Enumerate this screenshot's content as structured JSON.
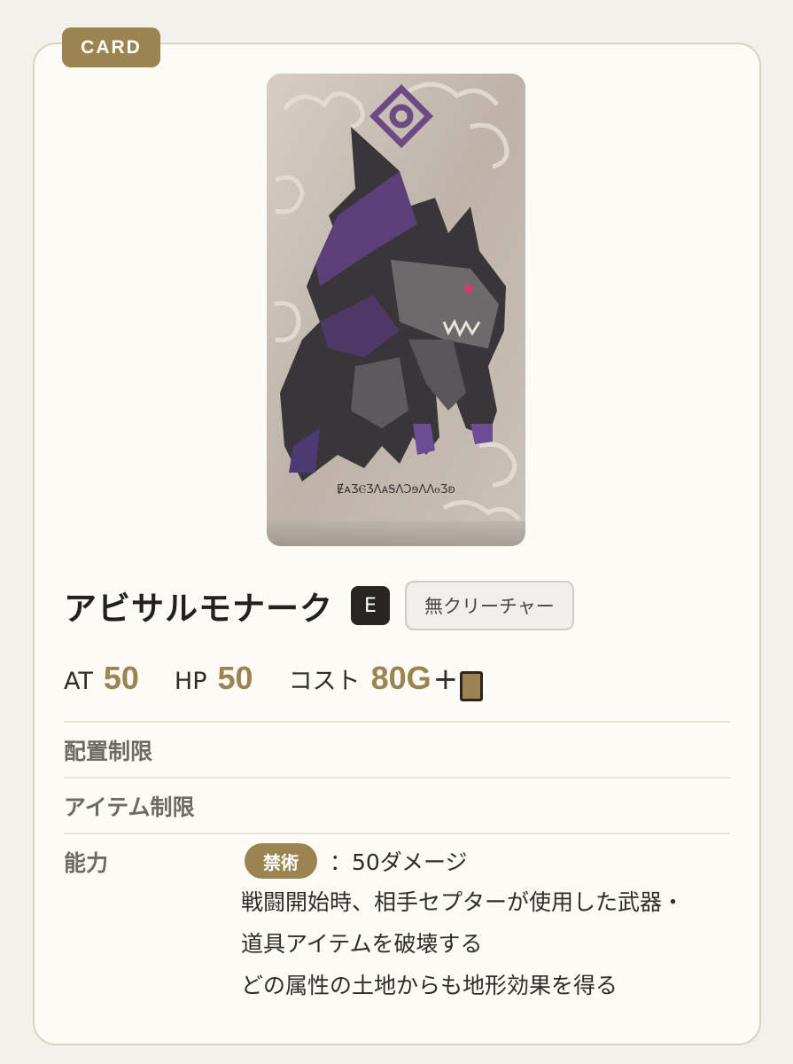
{
  "tag": "CARD",
  "card": {
    "name": "アビサルモナーク",
    "rank": "E",
    "type": "無クリーチャー",
    "art_script": "ɆᴀƷⲈƷɅᴀᎦɅƆɘɅɅⲑƷʚ"
  },
  "stats": {
    "at_label": "AT",
    "at_value": "50",
    "hp_label": "HP",
    "hp_value": "50",
    "cost_label": "コスト",
    "cost_value": "80G",
    "cost_plus": "+"
  },
  "rows": {
    "placement_label": "配置制限",
    "item_label": "アイテム制限",
    "ability_label": "能力"
  },
  "ability": {
    "tag": "禁術",
    "first_text": "：50ダメージ",
    "lines": [
      "戦闘開始時、相手セプターが使用した武器・",
      "道具アイテムを破壊する",
      "どの属性の土地からも地形効果を得る"
    ]
  },
  "colors": {
    "accent": "#9c8450",
    "rank_badge": "#2a2522",
    "panel_bg": "#fcfbf6",
    "border": "#d8d2c2"
  },
  "icons": {
    "card_cost": "card-icon"
  }
}
